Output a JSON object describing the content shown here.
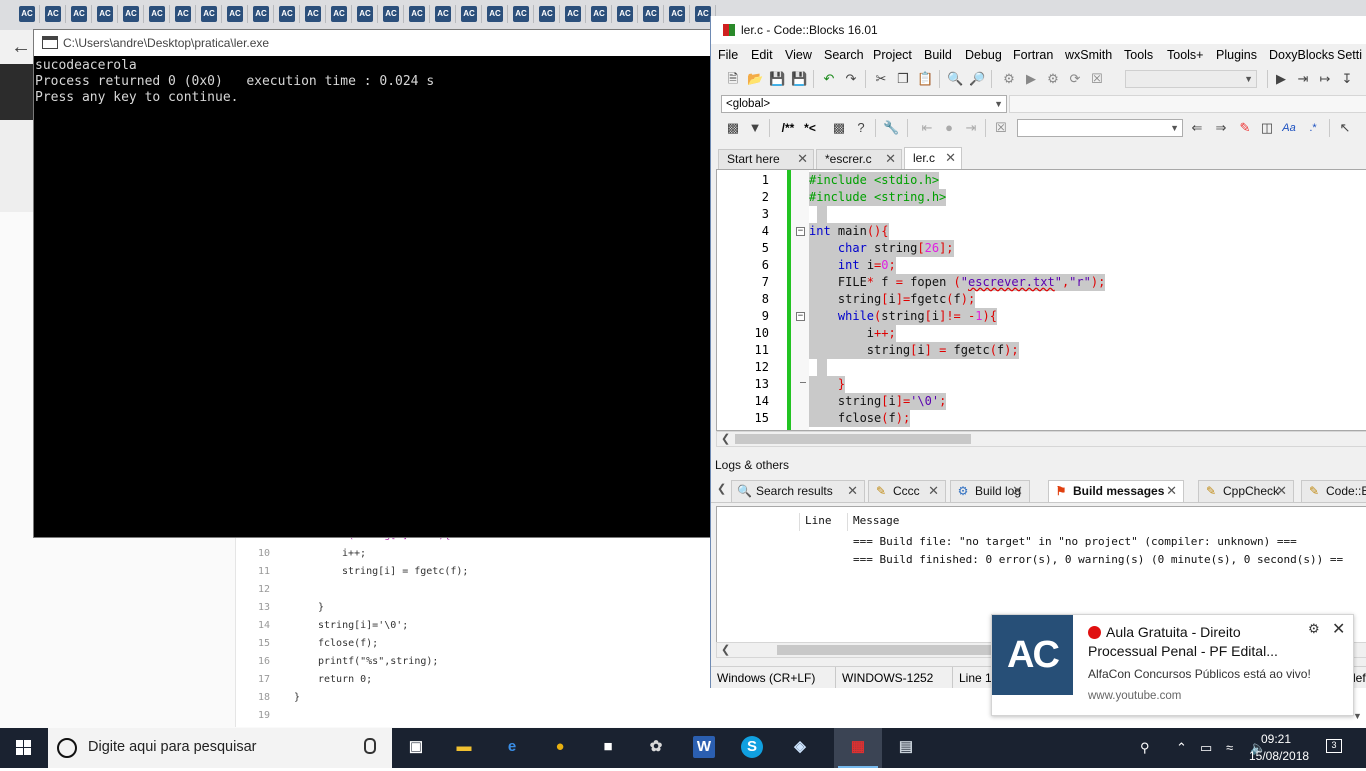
{
  "browser": {
    "tab_favicon_text": "AC",
    "back_icon": "arrow-left-icon"
  },
  "console": {
    "title": "C:\\Users\\andre\\Desktop\\pratica\\ler.exe",
    "output": "sucodeacerola\nProcess returned 0 (0x0)   execution time : 0.024 s\nPress any key to continue."
  },
  "background_code": {
    "partial_line": "while(string[i]!= -1){",
    "lines": [
      {
        "num": "10",
        "text": "i++;"
      },
      {
        "num": "11",
        "text": "string[i] = fgetc(f);"
      },
      {
        "num": "12",
        "text": ""
      },
      {
        "num": "13",
        "text": "}"
      },
      {
        "num": "14",
        "text": "string[i]='\\0';"
      },
      {
        "num": "15",
        "text": "fclose(f);"
      },
      {
        "num": "16",
        "text": "printf(\"%s\",string);"
      },
      {
        "num": "17",
        "text": "return 0;"
      },
      {
        "num": "18",
        "text": "}"
      },
      {
        "num": "19",
        "text": ""
      }
    ]
  },
  "codeblocks": {
    "title": "ler.c - Code::Blocks 16.01",
    "menu": [
      "File",
      "Edit",
      "View",
      "Search",
      "Project",
      "Build",
      "Debug",
      "Fortran",
      "wxSmith",
      "Tools",
      "Tools+",
      "Plugins",
      "DoxyBlocks",
      "Setti"
    ],
    "scope_combo": "<global>",
    "doxy_buttons": [
      "/**",
      "*<"
    ],
    "editor_tabs": [
      {
        "label": "Start here",
        "active": false
      },
      {
        "label": "*escrer.c",
        "active": false
      },
      {
        "label": "ler.c",
        "active": true
      }
    ],
    "line_numbers": [
      "1",
      "2",
      "3",
      "4",
      "5",
      "6",
      "7",
      "8",
      "9",
      "10",
      "11",
      "12",
      "13",
      "14",
      "15"
    ],
    "logs_title": "Logs & others",
    "log_tabs": [
      {
        "label": "Search results",
        "icon": "search-icon",
        "active": false
      },
      {
        "label": "Cccc",
        "icon": "pencil-icon",
        "active": false
      },
      {
        "label": "Build log",
        "icon": "gear-icon",
        "active": false
      },
      {
        "label": "Build messages",
        "icon": "flag-icon",
        "active": true
      },
      {
        "label": "CppCheck",
        "icon": "pencil-icon",
        "active": false
      },
      {
        "label": "Code::Bl",
        "icon": "pencil-icon",
        "active": false
      }
    ],
    "log_headers": {
      "line": "Line",
      "message": "Message"
    },
    "log_messages": [
      "=== Build file: \"no target\" in \"no project\" (compiler: unknown) ===",
      "=== Build finished: 0 error(s), 0 warning(s) (0 minute(s), 0 second(s)) =="
    ],
    "status": [
      "Windows (CR+LF)",
      "WINDOWS-1252",
      "Line 1,"
    ],
    "status_tail": "lef"
  },
  "notification": {
    "title": "Aula Gratuita - Direito Processual Penal - PF Edital...",
    "body": "AlfaCon Concursos Públicos está ao vivo!",
    "source": "www.youtube.com",
    "logo_text": "AC",
    "accent": "#274f77"
  },
  "taskbar": {
    "search_placeholder": "Digite aqui para pesquisar",
    "time": "09:21",
    "date": "15/08/2018",
    "notification_count": "3",
    "apps": [
      "task-view-icon",
      "file-explorer-icon",
      "edge-icon",
      "chrome-icon",
      "store-icon",
      "paint-icon",
      "word-icon",
      "skype-icon",
      "3d-builder-icon",
      "codeblocks-icon",
      "console-icon"
    ]
  }
}
